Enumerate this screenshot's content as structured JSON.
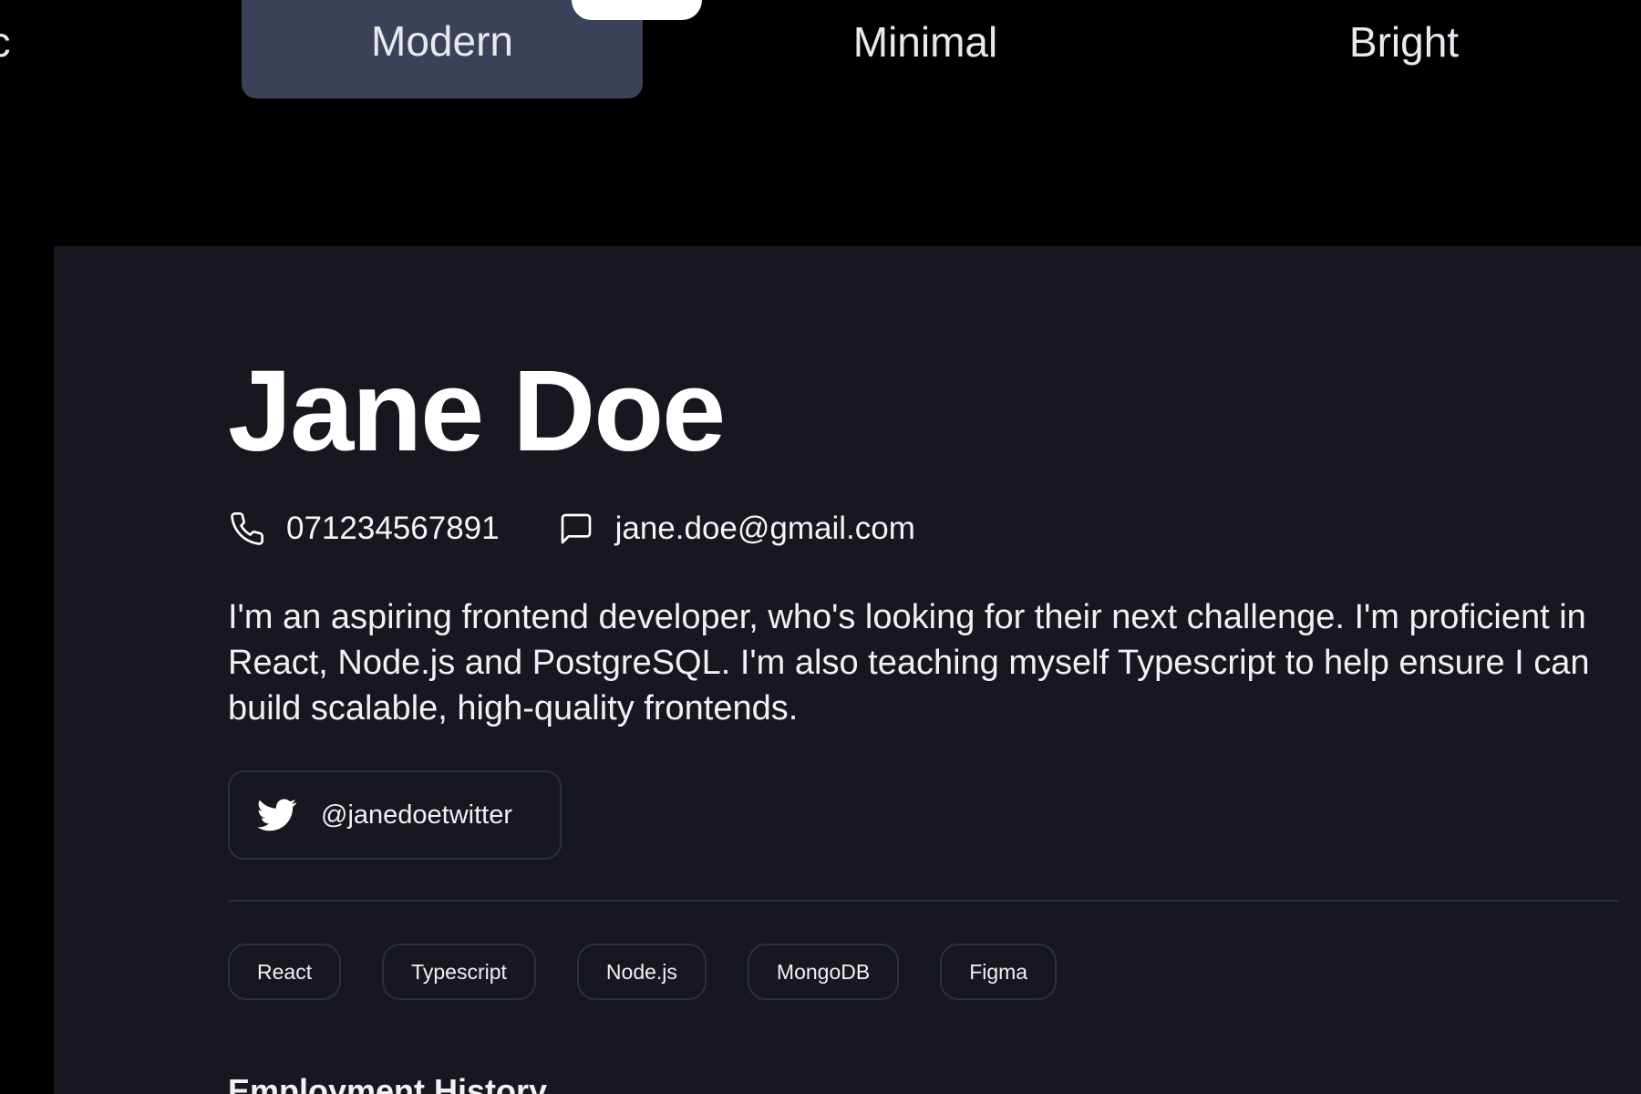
{
  "theme_tabs": {
    "partial_label": "c",
    "items": [
      {
        "label": "Modern",
        "selected": true
      },
      {
        "label": "Minimal",
        "selected": false
      },
      {
        "label": "Bright",
        "selected": false
      }
    ]
  },
  "resume": {
    "name": "Jane Doe",
    "phone": "071234567891",
    "email": "jane.doe@gmail.com",
    "bio": "I'm an aspiring frontend developer, who's looking for their next challenge. I'm proficient in React, Node.js and PostgreSQL. I'm also teaching myself Typescript to help ensure I can build scalable, high-quality frontends.",
    "social": {
      "handle": "@janedoetwitter",
      "icon": "twitter-icon"
    },
    "skills": [
      "React",
      "Typescript",
      "Node.js",
      "MongoDB",
      "Figma"
    ],
    "section_title": "Employment History"
  },
  "colors": {
    "background": "#000000",
    "card": "#17181f",
    "selected_tab": "#3b4158",
    "border": "#2d303d",
    "text": "#ffffff"
  }
}
